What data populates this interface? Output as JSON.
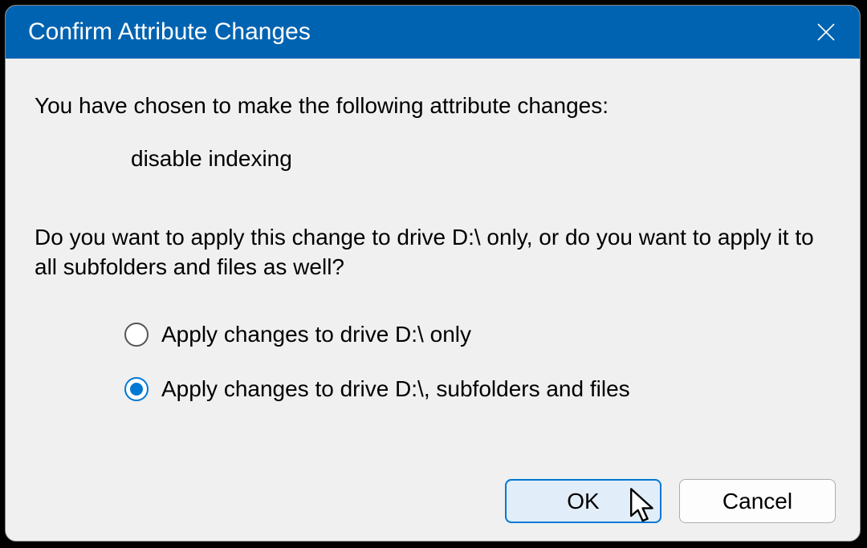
{
  "dialog": {
    "title": "Confirm Attribute Changes",
    "intro": "You have chosen to make the following attribute changes:",
    "change_item": "disable indexing",
    "question": "Do you want to apply this change to drive D:\\ only, or do you want to apply it to all subfolders and files as well?",
    "options": {
      "drive_only": "Apply changes to drive D:\\ only",
      "recursive": "Apply changes to drive D:\\, subfolders and files"
    },
    "buttons": {
      "ok": "OK",
      "cancel": "Cancel"
    }
  }
}
